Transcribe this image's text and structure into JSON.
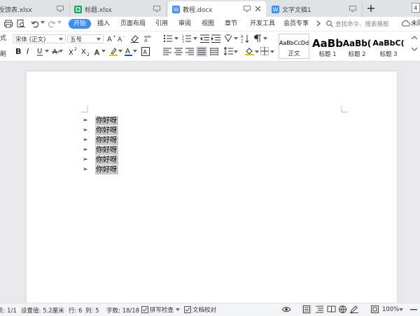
{
  "tabs": [
    {
      "label": "反馈表.xlsx",
      "icon": "spreadsheet-icon",
      "icon_color": "#1fa463",
      "active": false
    },
    {
      "label": "标题.xlsx",
      "icon": "spreadsheet-icon",
      "icon_color": "#1fa463",
      "active": false
    },
    {
      "label": "教程.docx",
      "icon": "writer-doc-icon",
      "icon_color": "#3f8cf5",
      "active": true
    },
    {
      "label": "文字文稿1",
      "icon": "writer-doc-icon",
      "icon_color": "#3f8cf5",
      "active": false
    }
  ],
  "menu": {
    "items": [
      "开始",
      "插入",
      "页面布局",
      "引用",
      "审阅",
      "视图",
      "章节",
      "开发工具",
      "会员专享"
    ],
    "search_placeholder": "查找命令、搜索模板",
    "unsaved_label": "未同"
  },
  "ribbon": {
    "font_name": "宋体 (正文)",
    "font_size": "五号",
    "styles": [
      {
        "sample": "AaBbCcDd",
        "name": "正文"
      },
      {
        "sample": "AaBb",
        "name": "标题 1"
      },
      {
        "sample": "AaBb(",
        "name": "标题 2"
      },
      {
        "sample": "AaBbC(",
        "name": "标题 3"
      }
    ],
    "left_cut_labels": [
      "式",
      "刷"
    ]
  },
  "document": {
    "bullet_glyph": "➢",
    "lines": [
      "你好呀",
      "你好呀",
      "你好呀",
      "你好呀",
      "你好呀",
      "你好呀"
    ]
  },
  "status": {
    "page": "页: 1/1",
    "position": "设置值: 5.2厘米",
    "row": "行: 6",
    "col": "列: 5",
    "word_count": "字数: 18/18",
    "spell_check": "拼写检查",
    "proofread": "文档校对",
    "zoom": "100%"
  },
  "colors": {
    "accent": "#3f8cf5",
    "highlight": "#c8c8c8",
    "font_color": "#1f4fcf",
    "highlight_marker": "#f2c200"
  }
}
